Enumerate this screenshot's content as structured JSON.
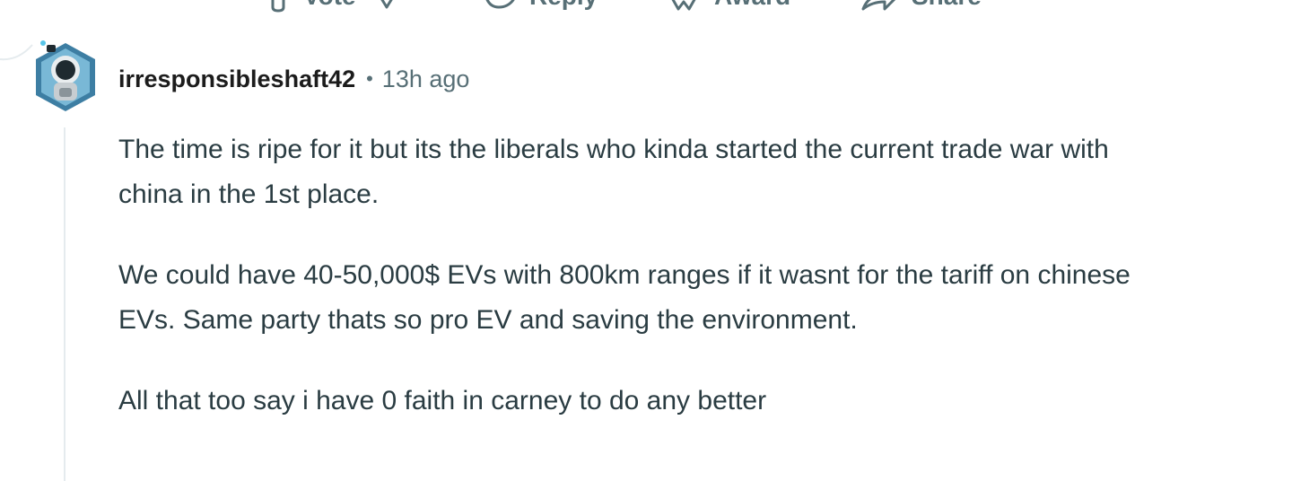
{
  "actions": {
    "vote_label": "Vote",
    "reply_label": "Reply",
    "award_label": "Award",
    "share_label": "Share"
  },
  "comment": {
    "username": "irresponsibleshaft42",
    "separator": "•",
    "timestamp": "13h ago",
    "paragraphs": [
      "The time is ripe for it but its the liberals who kinda started the current trade war with china in the 1st place.",
      "We could have 40-50,000$ EVs with 800km ranges if it wasnt for the tariff on chinese EVs. Same party thats so pro EV and saving the environment.",
      "All that too say i have 0 faith in carney to do any better"
    ]
  },
  "colors": {
    "meta_gray": "#576f76",
    "thread_line": "#e5ebee",
    "body_text": "#2a3c42"
  }
}
